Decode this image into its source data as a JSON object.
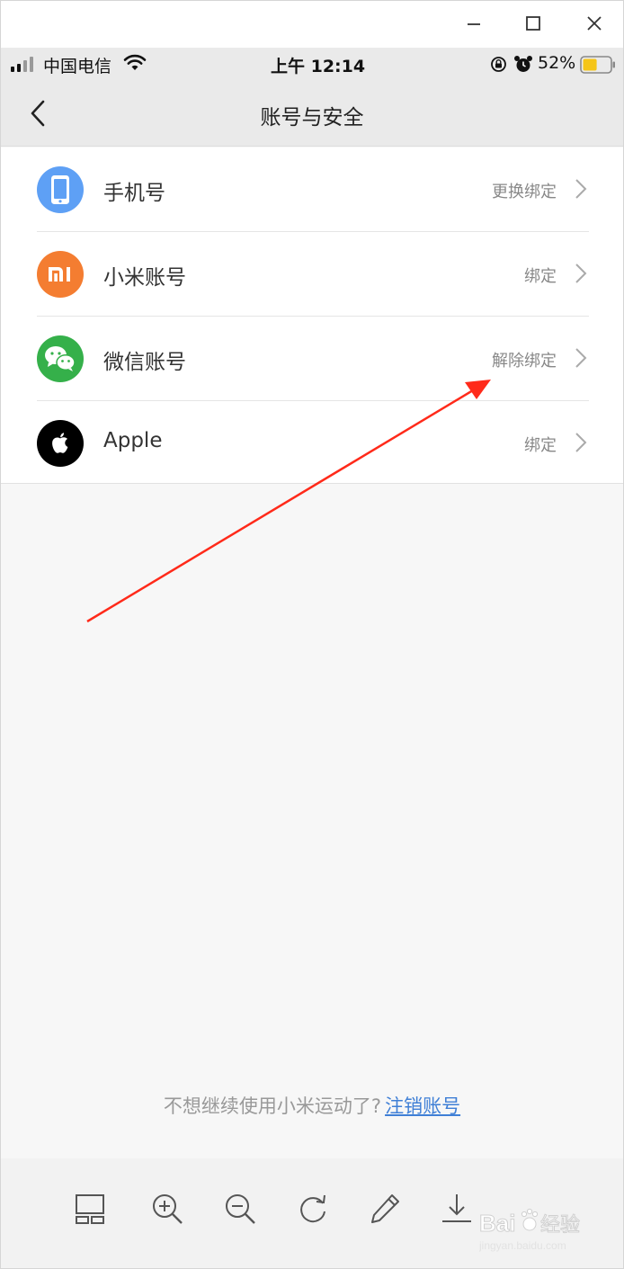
{
  "window": {
    "controls": [
      "minimize-icon",
      "maximize-icon",
      "close-icon"
    ]
  },
  "status_bar": {
    "carrier": "中国电信",
    "time": "上午 12:14",
    "battery": "52%",
    "battery_level": 0.52,
    "battery_color": "#f5c518"
  },
  "nav": {
    "title": "账号与安全"
  },
  "accounts": [
    {
      "label": "手机号",
      "action": "更换绑定",
      "icon": "phone-icon",
      "color": "#5ea0f5"
    },
    {
      "label": "小米账号",
      "action": "绑定",
      "icon": "mi-logo-icon",
      "color": "#f47d31"
    },
    {
      "label": "微信账号",
      "action": "解除绑定",
      "icon": "wechat-icon",
      "color": "#35b04a"
    },
    {
      "label": "Apple",
      "action": "绑定",
      "icon": "apple-icon",
      "color": "#000000"
    }
  ],
  "footer": {
    "prompt": "不想继续使用小米运动了?",
    "link": "注销账号"
  },
  "toolbar": {
    "items": [
      "thumbnails-icon",
      "zoom-in-icon",
      "zoom-out-icon",
      "rotate-icon",
      "edit-icon",
      "download-icon"
    ]
  },
  "annotation": {
    "arrow_color": "#ff2a1a"
  },
  "watermark": {
    "brand": "Bai",
    "brand_suffix": "经验",
    "url": "jingyan.baidu.com"
  }
}
